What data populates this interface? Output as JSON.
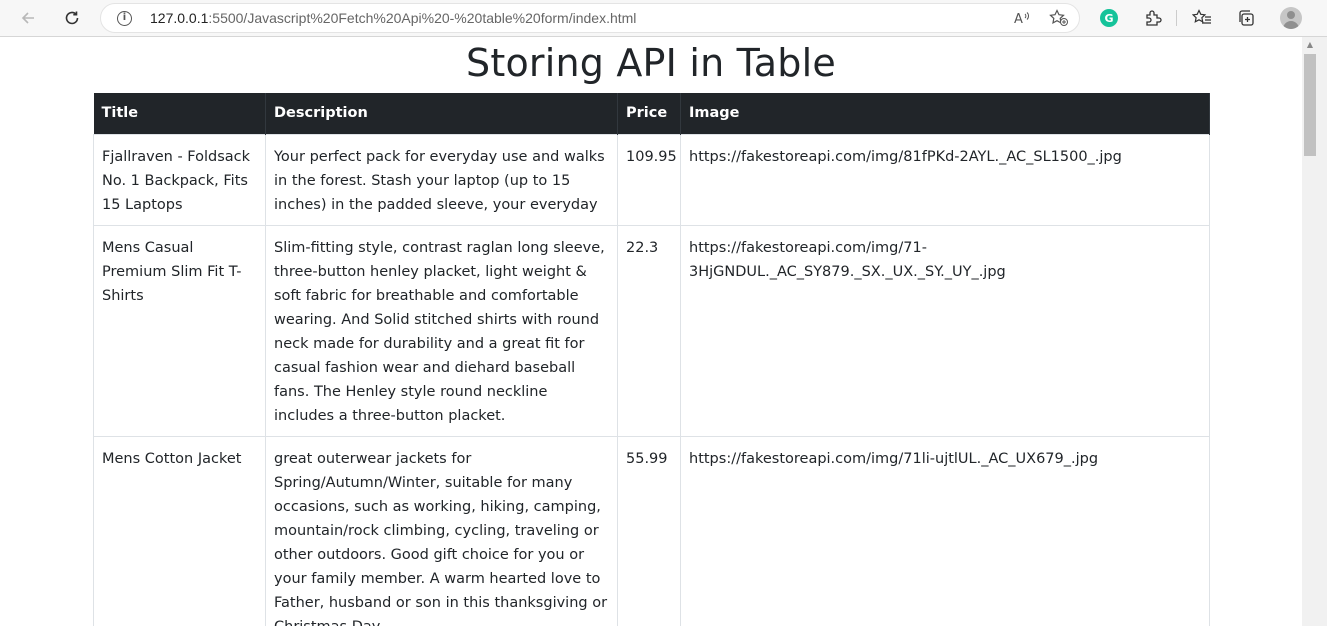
{
  "browser": {
    "url_host": "127.0.0.1",
    "url_rest": ":5500/Javascript%20Fetch%20Api%20-%20table%20form/index.html"
  },
  "page": {
    "title": "Storing API in Table"
  },
  "table": {
    "headers": [
      "Title",
      "Description",
      "Price",
      "Image"
    ],
    "rows": [
      {
        "title": "Fjallraven - Foldsack No. 1 Backpack, Fits 15 Laptops",
        "description": "Your perfect pack for everyday use and walks in the forest. Stash your laptop (up to 15 inches) in the padded sleeve, your everyday",
        "price": "109.95",
        "image": "https://fakestoreapi.com/img/81fPKd-2AYL._AC_SL1500_.jpg"
      },
      {
        "title": "Mens Casual Premium Slim Fit T-Shirts",
        "description": "Slim-fitting style, contrast raglan long sleeve, three-button henley placket, light weight & soft fabric for breathable and comfortable wearing. And Solid stitched shirts with round neck made for durability and a great fit for casual fashion wear and diehard baseball fans. The Henley style round neckline includes a three-button placket.",
        "price": "22.3",
        "image": "https://fakestoreapi.com/img/71-3HjGNDUL._AC_SY879._SX._UX._SY._UY_.jpg"
      },
      {
        "title": "Mens Cotton Jacket",
        "description": "great outerwear jackets for Spring/Autumn/Winter, suitable for many occasions, such as working, hiking, camping, mountain/rock climbing, cycling, traveling or other outdoors. Good gift choice for you or your family member. A warm hearted love to Father, husband or son in this thanksgiving or Christmas Day.",
        "price": "55.99",
        "image": "https://fakestoreapi.com/img/71li-ujtlUL._AC_UX679_.jpg"
      }
    ]
  }
}
